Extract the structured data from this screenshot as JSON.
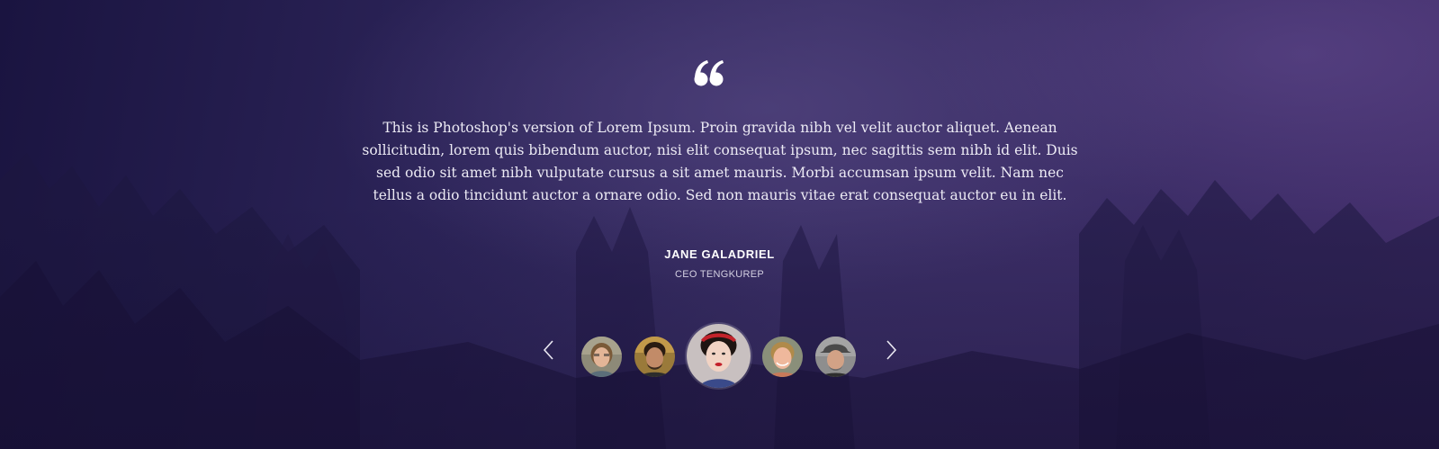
{
  "testimonial": {
    "quote_icon": "double-quote-icon",
    "text": "This is Photoshop's version  of Lorem Ipsum. Proin gravida nibh vel velit auctor aliquet. Aenean sollicitudin, lorem quis bibendum auctor, nisi elit consequat ipsum, nec sagittis sem nibh id elit. Duis sed odio sit amet nibh vulputate cursus a sit amet mauris. Morbi accumsan ipsum velit. Nam nec tellus a odio tincidunt auctor a ornare odio. Sed non  mauris vitae erat consequat auctor eu in elit.",
    "author_name": "JANE GALADRIEL",
    "author_role": "CEO TENGKUREP"
  },
  "carousel": {
    "prev_icon": "chevron-left-icon",
    "next_icon": "chevron-right-icon",
    "active_index": 2,
    "avatars": [
      {
        "name": "avatar-1"
      },
      {
        "name": "avatar-2"
      },
      {
        "name": "avatar-3"
      },
      {
        "name": "avatar-4"
      },
      {
        "name": "avatar-5"
      }
    ]
  },
  "colors": {
    "background": "#2c2250",
    "text": "#eceaf4",
    "accent": "#ffffff"
  }
}
